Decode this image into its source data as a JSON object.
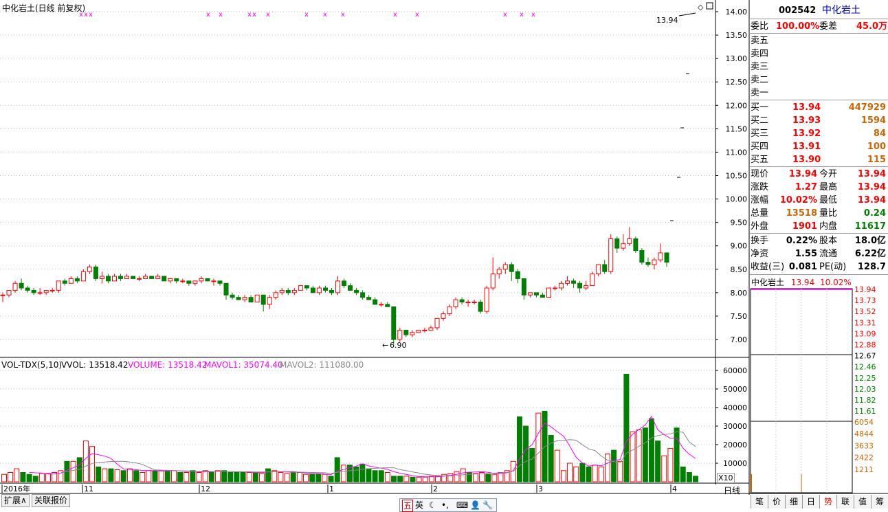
{
  "header": {
    "title": "中化岩土(日线 前复权)",
    "vol_label": "VOL-TDX(5,10)",
    "vvol": "VVOL: 13518.42",
    "volume": "VOLUME: 13518.42",
    "mavol1": "MAVOL1: 35074.40",
    "mavol2": "MAVOL2: 111080.00",
    "x10": "X10",
    "period": "日线"
  },
  "colors": {
    "up": "#ff0000",
    "down": "#008000",
    "ma5": "#ff00ff",
    "ma10": "#888888",
    "grid": "#bbbbbb"
  },
  "chart_data": [
    {
      "type": "candlestick",
      "title": "中化岩土(日线 前复权)",
      "ylim": [
        6.7,
        14.2
      ],
      "y_ticks": [
        "7.00",
        "7.50",
        "8.00",
        "8.50",
        "9.00",
        "9.50",
        "10.00",
        "10.50",
        "11.00",
        "11.50",
        "12.00",
        "12.50",
        "13.00",
        "13.50",
        "14.00"
      ],
      "x_ticks": [
        "2016年",
        "11",
        "12",
        "1",
        "2",
        "3",
        "4"
      ],
      "annotations": [
        "13.94",
        "6.90"
      ],
      "candles": [
        {
          "o": 7.95,
          "h": 8.0,
          "l": 7.8,
          "c": 7.95
        },
        {
          "o": 7.95,
          "h": 8.05,
          "l": 7.9,
          "c": 8.05
        },
        {
          "o": 8.05,
          "h": 8.25,
          "l": 8.0,
          "c": 8.2
        },
        {
          "o": 8.2,
          "h": 8.3,
          "l": 8.05,
          "c": 8.1
        },
        {
          "o": 8.1,
          "h": 8.15,
          "l": 8.0,
          "c": 8.05
        },
        {
          "o": 8.05,
          "h": 8.1,
          "l": 7.95,
          "c": 8.0
        },
        {
          "o": 8.0,
          "h": 8.1,
          "l": 7.95,
          "c": 8.0
        },
        {
          "o": 8.0,
          "h": 8.05,
          "l": 7.95,
          "c": 8.05
        },
        {
          "o": 8.05,
          "h": 8.1,
          "l": 8.0,
          "c": 8.05
        },
        {
          "o": 8.05,
          "h": 8.25,
          "l": 8.0,
          "c": 8.25
        },
        {
          "o": 8.25,
          "h": 8.3,
          "l": 8.15,
          "c": 8.2
        },
        {
          "o": 8.2,
          "h": 8.35,
          "l": 8.2,
          "c": 8.3
        },
        {
          "o": 8.3,
          "h": 8.35,
          "l": 8.2,
          "c": 8.25
        },
        {
          "o": 8.25,
          "h": 8.5,
          "l": 8.25,
          "c": 8.45
        },
        {
          "o": 8.45,
          "h": 8.6,
          "l": 8.4,
          "c": 8.55
        },
        {
          "o": 8.55,
          "h": 8.6,
          "l": 8.25,
          "c": 8.3
        },
        {
          "o": 8.3,
          "h": 8.45,
          "l": 8.2,
          "c": 8.35
        },
        {
          "o": 8.35,
          "h": 8.4,
          "l": 8.2,
          "c": 8.25
        },
        {
          "o": 8.25,
          "h": 8.4,
          "l": 8.25,
          "c": 8.35
        },
        {
          "o": 8.35,
          "h": 8.4,
          "l": 8.25,
          "c": 8.3
        },
        {
          "o": 8.3,
          "h": 8.4,
          "l": 8.3,
          "c": 8.35
        },
        {
          "o": 8.35,
          "h": 8.35,
          "l": 8.3,
          "c": 8.3
        },
        {
          "o": 8.3,
          "h": 8.35,
          "l": 8.25,
          "c": 8.3
        },
        {
          "o": 8.3,
          "h": 8.4,
          "l": 8.3,
          "c": 8.35
        },
        {
          "o": 8.35,
          "h": 8.35,
          "l": 8.3,
          "c": 8.3
        },
        {
          "o": 8.3,
          "h": 8.4,
          "l": 8.3,
          "c": 8.35
        },
        {
          "o": 8.35,
          "h": 8.35,
          "l": 8.25,
          "c": 8.25
        },
        {
          "o": 8.25,
          "h": 8.3,
          "l": 8.2,
          "c": 8.3
        },
        {
          "o": 8.3,
          "h": 8.3,
          "l": 8.2,
          "c": 8.25
        },
        {
          "o": 8.25,
          "h": 8.3,
          "l": 8.2,
          "c": 8.25
        },
        {
          "o": 8.25,
          "h": 8.25,
          "l": 8.15,
          "c": 8.2
        },
        {
          "o": 8.2,
          "h": 8.25,
          "l": 8.15,
          "c": 8.25
        },
        {
          "o": 8.25,
          "h": 8.35,
          "l": 8.2,
          "c": 8.3
        },
        {
          "o": 8.3,
          "h": 8.3,
          "l": 8.25,
          "c": 8.25
        },
        {
          "o": 8.25,
          "h": 8.3,
          "l": 8.15,
          "c": 8.25
        },
        {
          "o": 8.25,
          "h": 8.25,
          "l": 8.15,
          "c": 8.2
        },
        {
          "o": 8.2,
          "h": 8.2,
          "l": 7.85,
          "c": 7.95
        },
        {
          "o": 7.95,
          "h": 8.0,
          "l": 7.85,
          "c": 7.9
        },
        {
          "o": 7.9,
          "h": 7.95,
          "l": 7.85,
          "c": 7.85
        },
        {
          "o": 7.85,
          "h": 7.95,
          "l": 7.8,
          "c": 7.9
        },
        {
          "o": 7.9,
          "h": 7.95,
          "l": 7.8,
          "c": 7.8
        },
        {
          "o": 7.8,
          "h": 7.95,
          "l": 7.8,
          "c": 7.95
        },
        {
          "o": 7.95,
          "h": 7.95,
          "l": 7.6,
          "c": 7.75
        },
        {
          "o": 7.75,
          "h": 7.95,
          "l": 7.65,
          "c": 7.9
        },
        {
          "o": 7.9,
          "h": 8.05,
          "l": 7.85,
          "c": 8.0
        },
        {
          "o": 8.0,
          "h": 8.1,
          "l": 7.95,
          "c": 8.05
        },
        {
          "o": 8.05,
          "h": 8.1,
          "l": 7.95,
          "c": 8.0
        },
        {
          "o": 8.0,
          "h": 8.1,
          "l": 7.95,
          "c": 8.05
        },
        {
          "o": 8.05,
          "h": 8.15,
          "l": 8.05,
          "c": 8.15
        },
        {
          "o": 8.15,
          "h": 8.15,
          "l": 8.05,
          "c": 8.1
        },
        {
          "o": 8.1,
          "h": 8.15,
          "l": 8.0,
          "c": 8.0
        },
        {
          "o": 8.0,
          "h": 8.15,
          "l": 7.95,
          "c": 8.1
        },
        {
          "o": 8.1,
          "h": 8.15,
          "l": 8.0,
          "c": 8.05
        },
        {
          "o": 8.05,
          "h": 8.1,
          "l": 7.95,
          "c": 8.0
        },
        {
          "o": 8.0,
          "h": 8.35,
          "l": 7.95,
          "c": 8.25
        },
        {
          "o": 8.25,
          "h": 8.3,
          "l": 8.1,
          "c": 8.15
        },
        {
          "o": 8.15,
          "h": 8.2,
          "l": 8.05,
          "c": 8.05
        },
        {
          "o": 8.05,
          "h": 8.1,
          "l": 7.95,
          "c": 8.0
        },
        {
          "o": 8.0,
          "h": 8.05,
          "l": 7.85,
          "c": 7.9
        },
        {
          "o": 7.9,
          "h": 7.95,
          "l": 7.85,
          "c": 7.85
        },
        {
          "o": 7.85,
          "h": 7.9,
          "l": 7.75,
          "c": 7.75
        },
        {
          "o": 7.75,
          "h": 7.8,
          "l": 7.7,
          "c": 7.75
        },
        {
          "o": 7.75,
          "h": 7.8,
          "l": 7.7,
          "c": 7.7
        },
        {
          "o": 7.7,
          "h": 7.7,
          "l": 6.9,
          "c": 7.0
        },
        {
          "o": 7.0,
          "h": 7.25,
          "l": 6.95,
          "c": 7.2
        },
        {
          "o": 7.2,
          "h": 7.2,
          "l": 7.05,
          "c": 7.1
        },
        {
          "o": 7.1,
          "h": 7.2,
          "l": 7.05,
          "c": 7.15
        },
        {
          "o": 7.15,
          "h": 7.2,
          "l": 7.15,
          "c": 7.2
        },
        {
          "o": 7.2,
          "h": 7.25,
          "l": 7.15,
          "c": 7.2
        },
        {
          "o": 7.2,
          "h": 7.3,
          "l": 7.2,
          "c": 7.25
        },
        {
          "o": 7.25,
          "h": 7.45,
          "l": 7.2,
          "c": 7.45
        },
        {
          "o": 7.45,
          "h": 7.6,
          "l": 7.4,
          "c": 7.55
        },
        {
          "o": 7.55,
          "h": 7.75,
          "l": 7.5,
          "c": 7.7
        },
        {
          "o": 7.7,
          "h": 7.9,
          "l": 7.65,
          "c": 7.85
        },
        {
          "o": 7.85,
          "h": 7.9,
          "l": 7.75,
          "c": 7.8
        },
        {
          "o": 7.8,
          "h": 7.85,
          "l": 7.7,
          "c": 7.8
        },
        {
          "o": 7.8,
          "h": 7.85,
          "l": 7.75,
          "c": 7.8
        },
        {
          "o": 7.8,
          "h": 7.85,
          "l": 7.55,
          "c": 7.6
        },
        {
          "o": 7.6,
          "h": 8.15,
          "l": 7.55,
          "c": 8.1
        },
        {
          "o": 8.1,
          "h": 8.75,
          "l": 8.05,
          "c": 8.4
        },
        {
          "o": 8.4,
          "h": 8.55,
          "l": 8.3,
          "c": 8.5
        },
        {
          "o": 8.5,
          "h": 8.65,
          "l": 8.4,
          "c": 8.6
        },
        {
          "o": 8.6,
          "h": 8.65,
          "l": 8.25,
          "c": 8.45
        },
        {
          "o": 8.45,
          "h": 8.5,
          "l": 8.2,
          "c": 8.3
        },
        {
          "o": 8.3,
          "h": 8.3,
          "l": 7.85,
          "c": 7.95
        },
        {
          "o": 7.95,
          "h": 8.0,
          "l": 7.9,
          "c": 8.0
        },
        {
          "o": 8.0,
          "h": 8.0,
          "l": 7.9,
          "c": 7.95
        },
        {
          "o": 7.95,
          "h": 8.0,
          "l": 7.9,
          "c": 7.9
        },
        {
          "o": 7.9,
          "h": 8.1,
          "l": 7.9,
          "c": 8.1
        },
        {
          "o": 8.1,
          "h": 8.15,
          "l": 8.05,
          "c": 8.1
        },
        {
          "o": 8.1,
          "h": 8.25,
          "l": 8.05,
          "c": 8.2
        },
        {
          "o": 8.2,
          "h": 8.35,
          "l": 8.15,
          "c": 8.25
        },
        {
          "o": 8.25,
          "h": 8.3,
          "l": 8.1,
          "c": 8.2
        },
        {
          "o": 8.2,
          "h": 8.25,
          "l": 8.0,
          "c": 8.1
        },
        {
          "o": 8.1,
          "h": 8.25,
          "l": 8.05,
          "c": 8.15
        },
        {
          "o": 8.15,
          "h": 8.45,
          "l": 8.15,
          "c": 8.4
        },
        {
          "o": 8.4,
          "h": 8.6,
          "l": 8.35,
          "c": 8.6
        },
        {
          "o": 8.6,
          "h": 8.7,
          "l": 8.4,
          "c": 8.45
        },
        {
          "o": 8.45,
          "h": 9.25,
          "l": 8.4,
          "c": 9.15
        },
        {
          "o": 9.15,
          "h": 9.2,
          "l": 8.85,
          "c": 8.95
        },
        {
          "o": 8.95,
          "h": 9.25,
          "l": 8.9,
          "c": 9.05
        },
        {
          "o": 9.05,
          "h": 9.4,
          "l": 9.0,
          "c": 9.15
        },
        {
          "o": 9.15,
          "h": 9.2,
          "l": 8.85,
          "c": 8.9
        },
        {
          "o": 8.9,
          "h": 8.95,
          "l": 8.6,
          "c": 8.65
        },
        {
          "o": 8.65,
          "h": 8.75,
          "l": 8.55,
          "c": 8.6
        },
        {
          "o": 8.6,
          "h": 8.75,
          "l": 8.5,
          "c": 8.7
        },
        {
          "o": 8.7,
          "h": 9.05,
          "l": 8.65,
          "c": 8.85
        },
        {
          "o": 8.85,
          "h": 8.85,
          "l": 8.55,
          "c": 8.65
        }
      ],
      "markers": [
        "x",
        "x",
        "x",
        "x",
        "x",
        "x",
        "x",
        "x",
        "x",
        "x",
        "x",
        "x",
        "x",
        "x",
        "x",
        "x",
        "x",
        "x",
        "x",
        "x"
      ]
    },
    {
      "type": "bar",
      "title": "VOL-TDX(5,10)",
      "ylim": [
        0,
        65000
      ],
      "y_ticks": [
        "10000",
        "20000",
        "30000",
        "40000",
        "50000",
        "60000"
      ],
      "series": [
        {
          "name": "VOLUME",
          "values": [
            4000,
            5000,
            7000,
            5000,
            4000,
            3000,
            4500,
            4500,
            5000,
            6000,
            11000,
            11000,
            13000,
            22000,
            19000,
            8000,
            7000,
            7000,
            6500,
            6000,
            7000,
            6000,
            5000,
            6000,
            6000,
            6000,
            6000,
            6000,
            5000,
            5000,
            6000,
            5000,
            6000,
            5000,
            6000,
            6000,
            5000,
            5000,
            5000,
            5000,
            5000,
            4500,
            7000,
            6000,
            5000,
            4500,
            5000,
            5000,
            4000,
            4000,
            4000,
            4000,
            3000,
            13000,
            9000,
            9000,
            8000,
            9500,
            7000,
            6000,
            6000,
            5000,
            3000,
            3000,
            3000,
            2500,
            2500,
            2500,
            3000,
            3000,
            4000,
            4500,
            5500,
            7000,
            5000,
            4500,
            5000,
            4000,
            4000,
            5000,
            6000,
            11000,
            35000,
            30000,
            18000,
            37000,
            38000,
            25000,
            17000,
            6000,
            10000,
            8000,
            10000,
            8000,
            9000,
            8000,
            15000,
            17000,
            11000,
            58000,
            27000,
            28000,
            29000,
            34000,
            22000,
            14000,
            18000,
            29000,
            8000,
            5000,
            3000
          ]
        },
        {
          "name": "MAVOL1",
          "values": []
        },
        {
          "name": "MAVOL2",
          "values": []
        }
      ]
    },
    {
      "type": "line",
      "title": "中化岩土 13.94 10.02%",
      "y_ticks": [
        "13.94",
        "13.73",
        "13.52",
        "13.31",
        "13.09",
        "12.88",
        "12.67",
        "12.46",
        "12.25",
        "12.03",
        "11.82",
        "11.61"
      ],
      "volume_ticks": [
        "6054",
        "4844",
        "3633",
        "2422",
        "1211"
      ]
    }
  ],
  "quote": {
    "code": "002542",
    "name": "中化岩土",
    "weibi_label": "委比",
    "weibi": "100.00%",
    "weicha_label": "委差",
    "weicha": "45.0万",
    "sells": [
      "卖五",
      "卖四",
      "卖三",
      "卖二",
      "卖一"
    ],
    "buys": [
      {
        "label": "买一",
        "price": "13.94",
        "vol": "447929"
      },
      {
        "label": "买二",
        "price": "13.93",
        "vol": "1594"
      },
      {
        "label": "买三",
        "price": "13.92",
        "vol": "84"
      },
      {
        "label": "买四",
        "price": "13.91",
        "vol": "100"
      },
      {
        "label": "买五",
        "price": "13.90",
        "vol": "115"
      }
    ],
    "stats": [
      {
        "l1": "现价",
        "v1": "13.94",
        "l2": "今开",
        "v2": "13.94"
      },
      {
        "l1": "涨跌",
        "v1": "1.27",
        "l2": "最高",
        "v2": "13.94"
      },
      {
        "l1": "涨幅",
        "v1": "10.02%",
        "l2": "最低",
        "v2": "13.94"
      },
      {
        "l1": "总量",
        "v1": "13518",
        "l2": "量比",
        "v2": "0.24"
      },
      {
        "l1": "外盘",
        "v1": "1901",
        "l2": "内盘",
        "v2": "11617"
      }
    ],
    "fund": [
      {
        "l1": "换手",
        "v1": "0.22%",
        "l2": "股本",
        "v2": "18.0亿"
      },
      {
        "l1": "净资",
        "v1": "1.55",
        "l2": "流通",
        "v2": "6.22亿"
      },
      {
        "l1": "收益(三)",
        "v1": "0.081",
        "l2": "PE(动)",
        "v2": "128.7"
      }
    ],
    "mini_title": "中化岩土",
    "mini_price": "13.94",
    "mini_pct": "10.02%"
  },
  "bottom_tabs": [
    "扩展∧",
    "关联报价"
  ],
  "right_tabs": [
    "笔",
    "价",
    "细",
    "日",
    "势",
    "联",
    "值",
    "筹"
  ],
  "ime": {
    "a": "五",
    "b": "英"
  }
}
